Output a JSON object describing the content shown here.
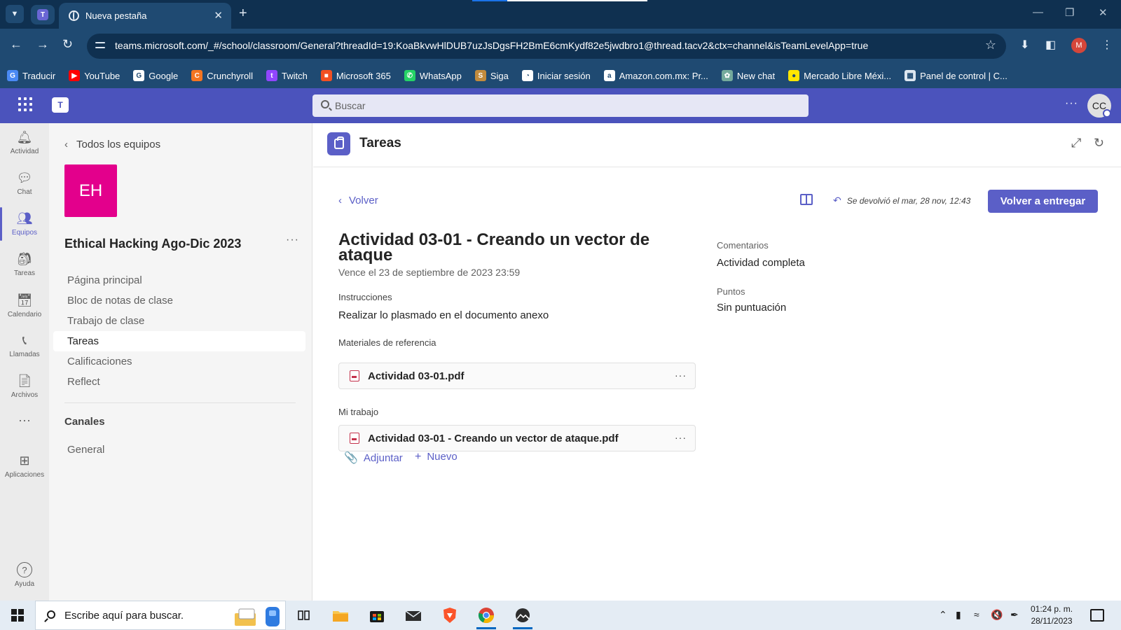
{
  "browser": {
    "tab_title": "Nueva pestaña",
    "url": "teams.microsoft.com/_#/school/classroom/General?threadId=19:KoaBkvwHlDUB7uzJsDgsFH2BmE6cmKydf82e5jwdbro1@thread.tacv2&ctx=channel&isTeamLevelApp=true",
    "profile_initial": "M",
    "bookmarks": [
      {
        "label": "Traducir",
        "icon": "translate-icon",
        "color": "#4a8af4"
      },
      {
        "label": "YouTube",
        "icon": "youtube-icon",
        "color": "#ff0000"
      },
      {
        "label": "Google",
        "icon": "google-icon",
        "color": "#ffffff"
      },
      {
        "label": "Crunchyroll",
        "icon": "crunchyroll-icon",
        "color": "#f47521"
      },
      {
        "label": "Twitch",
        "icon": "twitch-icon",
        "color": "#9146ff"
      },
      {
        "label": "Microsoft 365",
        "icon": "microsoft365-icon",
        "color": "#f25022"
      },
      {
        "label": "WhatsApp",
        "icon": "whatsapp-icon",
        "color": "#25d366"
      },
      {
        "label": "Siga",
        "icon": "siga-icon",
        "color": "#c28b3d"
      },
      {
        "label": "Iniciar sesión",
        "icon": "login-icon",
        "color": "#ffffff"
      },
      {
        "label": "Amazon.com.mx: Pr...",
        "icon": "amazon-icon",
        "color": "#ffffff"
      },
      {
        "label": "New chat",
        "icon": "chatgpt-icon",
        "color": "#74aa9c"
      },
      {
        "label": "Mercado Libre Méxi...",
        "icon": "mercadolibre-icon",
        "color": "#ffe600"
      },
      {
        "label": "Panel de control | C...",
        "icon": "panel-icon",
        "color": "#dce6f0"
      }
    ]
  },
  "teams": {
    "search_placeholder": "Buscar",
    "user_initials": "CC",
    "rail": [
      {
        "label": "Actividad",
        "icon": "bell-icon"
      },
      {
        "label": "Chat",
        "icon": "chat-icon"
      },
      {
        "label": "Equipos",
        "icon": "teams-icon",
        "active": true
      },
      {
        "label": "Tareas",
        "icon": "assignments-icon"
      },
      {
        "label": "Calendario",
        "icon": "calendar-icon"
      },
      {
        "label": "Llamadas",
        "icon": "phone-icon"
      },
      {
        "label": "Archivos",
        "icon": "file-icon"
      },
      {
        "label": "...",
        "icon": "more-icon"
      },
      {
        "label": "Aplicaciones",
        "icon": "apps-icon"
      },
      {
        "label": "Ayuda",
        "icon": "help-icon"
      }
    ],
    "team_pane": {
      "back_label": "Todos los equipos",
      "tile_initials": "EH",
      "tile_color": "#e3008c",
      "team_name": "Ethical Hacking Ago-Dic 2023",
      "nav": [
        "Página principal",
        "Bloc de notas de clase",
        "Trabajo de clase",
        "Tareas",
        "Calificaciones",
        "Reflect"
      ],
      "active_nav": "Tareas",
      "channels_heading": "Canales",
      "channels": [
        "General"
      ]
    },
    "app_header": {
      "title": "Tareas"
    },
    "assignment": {
      "back_label": "Volver",
      "returned_text": "Se devolvió el mar, 28 nov, 12:43",
      "resubmit_label": "Volver a entregar",
      "title": "Actividad 03-01 - Creando un vector de ataque",
      "due": "Vence el 23 de septiembre de 2023 23:59",
      "instructions_label": "Instrucciones",
      "instructions": "Realizar lo plasmado en el documento anexo",
      "reference_label": "Materiales de referencia",
      "reference_file": "Actividad 03-01.pdf",
      "my_work_label": "Mi trabajo",
      "my_work_file": "Actividad 03-01 - Creando un vector de ataque.pdf",
      "attach_label": "Adjuntar",
      "new_label": "Nuevo",
      "comments_label": "Comentarios",
      "comments": "Actividad completa",
      "points_label": "Puntos",
      "points": "Sin puntuación"
    },
    "accent_color": "#5b5fc7",
    "header_color": "#4b53bc"
  },
  "taskbar": {
    "search_placeholder": "Escribe aquí para buscar.",
    "time": "01:24 p. m.",
    "date": "28/11/2023"
  }
}
